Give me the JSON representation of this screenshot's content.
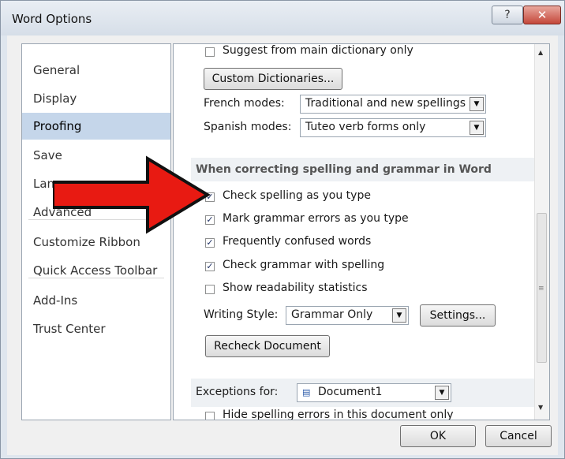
{
  "window": {
    "title": "Word Options",
    "help": "?",
    "close": "✕"
  },
  "nav": {
    "items": [
      "General",
      "Display",
      "Proofing",
      "Save",
      "Language",
      "Advanced",
      "Customize Ribbon",
      "Quick Access Toolbar",
      "Add-Ins",
      "Trust Center"
    ],
    "selected": "Proofing"
  },
  "content": {
    "suggest_main": "Suggest from main dictionary only",
    "custom_dict_button": "Custom Dictionaries...",
    "french": {
      "label": "French modes:",
      "value": "Traditional and new spellings"
    },
    "spanish": {
      "label": "Spanish modes:",
      "value": "Tuteo verb forms only"
    },
    "section_title": "When correcting spelling and grammar in Word",
    "options": [
      {
        "label": "Check spelling as you type",
        "checked": true
      },
      {
        "label": "Mark grammar errors as you type",
        "checked": true
      },
      {
        "label": "Frequently confused words",
        "checked": true
      },
      {
        "label": "Check grammar with spelling",
        "checked": true
      },
      {
        "label": "Show readability statistics",
        "checked": false
      }
    ],
    "writing_style": {
      "label": "Writing Style:",
      "value": "Grammar Only"
    },
    "settings_button": "Settings...",
    "recheck_button": "Recheck Document",
    "exceptions": {
      "label": "Exceptions for:",
      "document": "Document1"
    },
    "hide_errors": "Hide spelling errors in this document only"
  },
  "footer": {
    "ok": "OK",
    "cancel": "Cancel"
  },
  "colors": {
    "arrow": "#e81a12",
    "selected_nav": "#c5d6ea"
  }
}
